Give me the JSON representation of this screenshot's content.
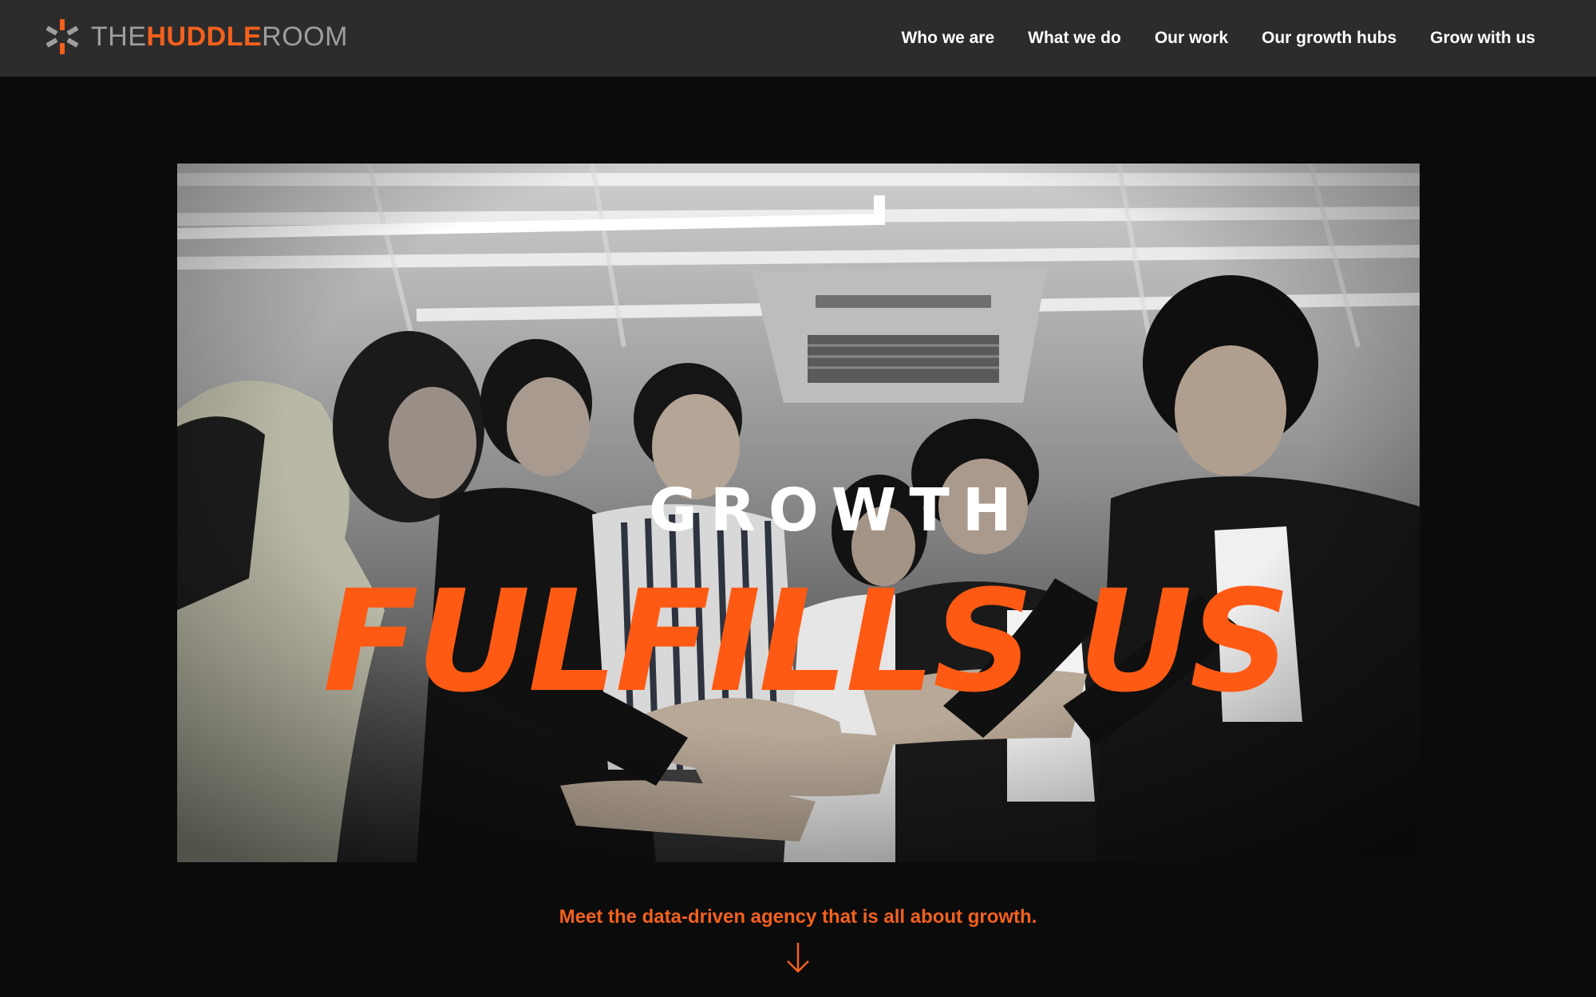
{
  "brand": {
    "the": "THE",
    "huddle": "HUDDLE",
    "room": "ROOM",
    "logo_icon": "burst-logo-icon",
    "accent_color": "#f2611d"
  },
  "nav": {
    "items": [
      {
        "label": "Who we are"
      },
      {
        "label": "What we do"
      },
      {
        "label": "Our work"
      },
      {
        "label": "Our growth hubs"
      },
      {
        "label": "Grow with us"
      }
    ]
  },
  "hero": {
    "kicker": "GROWTH",
    "headline": "FULFILLS US",
    "headline_color": "#ff5a14"
  },
  "footer_cta": {
    "tagline": "Meet the data-driven agency that is all about growth.",
    "arrow_icon": "arrow-down-icon"
  }
}
